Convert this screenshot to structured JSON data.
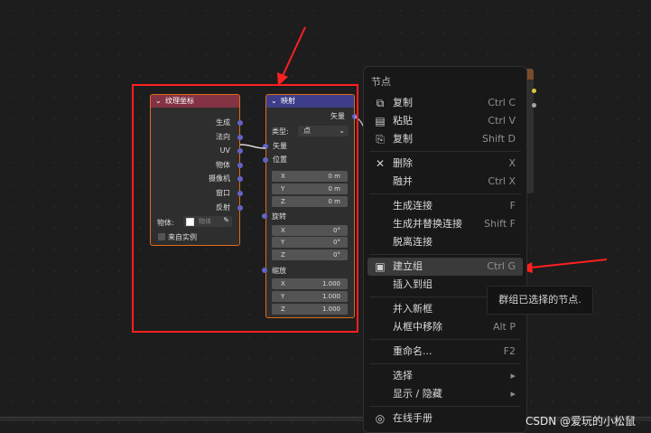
{
  "node_texcoord": {
    "title": "纹理坐标",
    "outputs": [
      "生成",
      "法向",
      "UV",
      "物体",
      "摄像机",
      "窗口",
      "反射"
    ],
    "object_label": "物体:",
    "object_value": "物体",
    "from_instancer": "来自实例"
  },
  "node_mapping": {
    "title": "映射",
    "output_vector": "矢量",
    "type_label": "类型:",
    "type_value": "点",
    "input_vector": "矢量",
    "location_label": "位置",
    "location": {
      "x": "0 m",
      "y": "0 m",
      "z": "0 m"
    },
    "rotation_label": "旋转",
    "rotation": {
      "x": "0°",
      "y": "0°",
      "z": "0°"
    },
    "scale_label": "缩放",
    "scale": {
      "x": "1.000",
      "y": "1.000",
      "z": "1.000"
    },
    "axis_x": "X",
    "axis_y": "Y",
    "axis_z": "Z"
  },
  "menu": {
    "title": "节点",
    "items": [
      {
        "label": "复制",
        "shortcut": "Ctrl C",
        "icon": "copy-icon"
      },
      {
        "label": "粘贴",
        "shortcut": "Ctrl V",
        "icon": "paste-icon"
      },
      {
        "label": "复制",
        "shortcut": "Shift D",
        "icon": "duplicate-icon"
      },
      {
        "label": "删除",
        "shortcut": "X",
        "icon": "x-icon"
      },
      {
        "label": "融并",
        "shortcut": "Ctrl X",
        "icon": ""
      },
      {
        "label": "生成连接",
        "shortcut": "F",
        "icon": ""
      },
      {
        "label": "生成并替换连接",
        "shortcut": "Shift F",
        "icon": ""
      },
      {
        "label": "脱离连接",
        "shortcut": "",
        "icon": ""
      },
      {
        "label": "建立组",
        "shortcut": "Ctrl G",
        "icon": "group-icon"
      },
      {
        "label": "插入到组",
        "shortcut": "",
        "icon": ""
      },
      {
        "label": "并入新框",
        "shortcut": "",
        "icon": ""
      },
      {
        "label": "从框中移除",
        "shortcut": "Alt P",
        "icon": ""
      },
      {
        "label": "重命名...",
        "shortcut": "F2",
        "icon": ""
      },
      {
        "label": "选择",
        "shortcut": "▸",
        "icon": ""
      },
      {
        "label": "显示 / 隐藏",
        "shortcut": "▸",
        "icon": ""
      },
      {
        "label": "在线手册",
        "shortcut": "",
        "icon": "globe-icon"
      }
    ]
  },
  "tooltip": "群组已选择的节点.",
  "watermark": "CSDN @爱玩的小松鼠",
  "colors": {
    "accent": "#e06b17",
    "annotation": "#ff2020",
    "texcoord_header": "#843345",
    "mapping_header": "#3d3d8a"
  }
}
